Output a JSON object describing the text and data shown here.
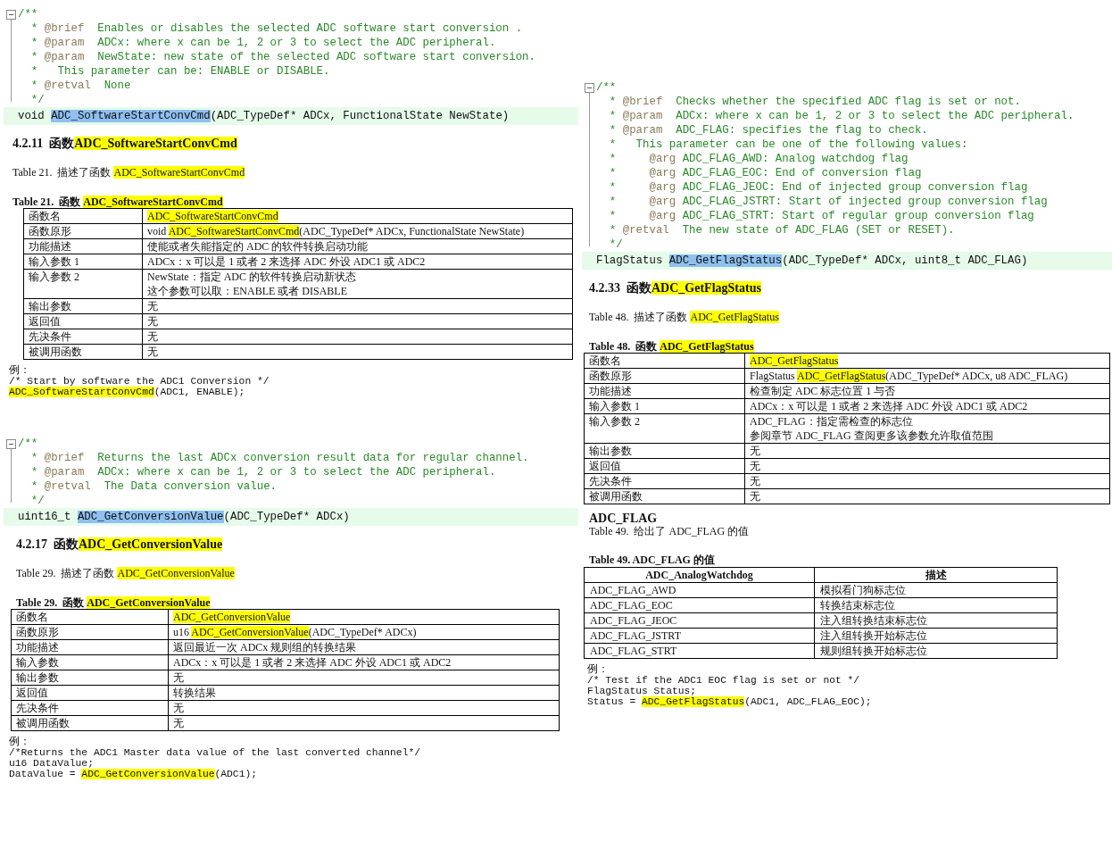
{
  "columns": [
    {
      "sections": [
        {
          "code": {
            "lines": [
              {
                "kind": "open",
                "text": "/**"
              },
              {
                "kind": "tag",
                "lead": "*",
                "tag": "@brief",
                "text": "Enables or disables the selected ADC software start conversion ."
              },
              {
                "kind": "tag",
                "lead": "*",
                "tag": "@param",
                "text": "ADCx: where x can be 1, 2 or 3 to select the ADC peripheral."
              },
              {
                "kind": "tag",
                "lead": "*",
                "tag": "@param",
                "text": "NewState: new state of the selected ADC software start conversion."
              },
              {
                "kind": "plain",
                "lead": "*",
                "text": "This parameter can be: ENABLE or DISABLE."
              },
              {
                "kind": "tag",
                "lead": "*",
                "tag": "@retval",
                "text": "None"
              },
              {
                "kind": "close",
                "text": "*/"
              }
            ],
            "signature": [
              {
                "text": "void ",
                "selected": false
              },
              {
                "text": "ADC_SoftwareStartConvCmd",
                "selected": true
              },
              {
                "text": "(ADC_TypeDef* ADCx, FunctionalState NewState)",
                "selected": false
              }
            ]
          },
          "heading": {
            "number": "4.2.11",
            "parts": [
              {
                "text": "函数",
                "highlight": false
              },
              {
                "text": "ADC_SoftwareStartConvCmd",
                "highlight": true
              }
            ]
          },
          "description": [
            {
              "text": "Table 21.  描述了函数 ",
              "highlight": false
            },
            {
              "text": "ADC_SoftwareStartConvCmd",
              "highlight": true
            }
          ],
          "caption": [
            {
              "text": "Table 21.  函数 ",
              "highlight": false
            },
            {
              "text": "ADC_SoftwareStartConvCmd",
              "highlight": true
            }
          ],
          "table": [
            {
              "label": "函数名",
              "lines": [
                [
                  {
                    "text": "ADC_SoftwareStartConvCmd",
                    "highlight": true
                  }
                ]
              ]
            },
            {
              "label": "函数原形",
              "lines": [
                [
                  {
                    "text": "void ",
                    "highlight": false
                  },
                  {
                    "text": "ADC_SoftwareStartConvCmd",
                    "highlight": true
                  },
                  {
                    "text": "(ADC_TypeDef* ADCx, FunctionalState NewState)",
                    "highlight": false
                  }
                ]
              ]
            },
            {
              "label": "功能描述",
              "lines": [
                "使能或者失能指定的 ADC 的软件转换启动功能"
              ]
            },
            {
              "label": "输入参数 1",
              "lines": [
                "ADCx：x 可以是 1 或者 2 来选择 ADC 外设 ADC1 或 ADC2"
              ]
            },
            {
              "label": "输入参数 2",
              "lines": [
                "NewState：指定 ADC 的软件转换启动新状态",
                "这个参数可以取：ENABLE 或者 DISABLE"
              ]
            },
            {
              "label": "输出参数",
              "lines": [
                "无"
              ]
            },
            {
              "label": "返回值",
              "lines": [
                "无"
              ]
            },
            {
              "label": "先决条件",
              "lines": [
                "无"
              ]
            },
            {
              "label": "被调用函数",
              "lines": [
                "无"
              ]
            }
          ],
          "example": {
            "label": "例：",
            "lines": [
              "/* Start by software the ADC1 Conversion */",
              [
                {
                  "text": "ADC_SoftwareStartConvCmd",
                  "highlight": true
                },
                {
                  "text": "(ADC1, ENABLE);",
                  "highlight": false
                }
              ]
            ]
          }
        },
        {
          "code": {
            "lines": [
              {
                "kind": "open",
                "text": "/**"
              },
              {
                "kind": "tag",
                "lead": "*",
                "tag": "@brief",
                "text": "Returns the last ADCx conversion result data for regular channel."
              },
              {
                "kind": "tag",
                "lead": "*",
                "tag": "@param",
                "text": "ADCx: where x can be 1, 2 or 3 to select the ADC peripheral."
              },
              {
                "kind": "tag",
                "lead": "*",
                "tag": "@retval",
                "text": "The Data conversion value."
              },
              {
                "kind": "close",
                "text": "*/"
              }
            ],
            "signature": [
              {
                "text": "uint16_t ",
                "selected": false
              },
              {
                "text": "ADC_GetConversionValue",
                "selected": true
              },
              {
                "text": "(ADC_TypeDef* ADCx)",
                "selected": false
              }
            ]
          },
          "heading": {
            "number": "4.2.17",
            "parts": [
              {
                "text": "函数",
                "highlight": false
              },
              {
                "text": "ADC_GetConversionValue",
                "highlight": true
              }
            ]
          },
          "description": [
            {
              "text": "Table 29.  描述了函数 ",
              "highlight": false
            },
            {
              "text": "ADC_GetConversionValue",
              "highlight": true
            }
          ],
          "caption": [
            {
              "text": "Table 29.  函数 ",
              "highlight": false
            },
            {
              "text": "ADC_GetConversionValue",
              "highlight": true
            }
          ],
          "table": [
            {
              "label": "函数名",
              "lines": [
                [
                  {
                    "text": "ADC_GetConversionValue",
                    "highlight": true
                  }
                ]
              ]
            },
            {
              "label": "函数原形",
              "lines": [
                [
                  {
                    "text": "u16 ",
                    "highlight": false
                  },
                  {
                    "text": "ADC_GetConversionValue",
                    "highlight": true
                  },
                  {
                    "text": "(ADC_TypeDef* ADCx)",
                    "highlight": false
                  }
                ]
              ]
            },
            {
              "label": "功能描述",
              "lines": [
                "返回最近一次 ADCx 规则组的转换结果"
              ]
            },
            {
              "label": "输入参数",
              "lines": [
                "ADCx：x 可以是 1 或者 2 来选择 ADC 外设 ADC1 或 ADC2"
              ]
            },
            {
              "label": "输出参数",
              "lines": [
                "无"
              ]
            },
            {
              "label": "返回值",
              "lines": [
                "转换结果"
              ]
            },
            {
              "label": "先决条件",
              "lines": [
                "无"
              ]
            },
            {
              "label": "被调用函数",
              "lines": [
                "无"
              ]
            }
          ],
          "example": {
            "label": "例：",
            "lines": [
              "/*Returns the ADC1 Master data value of the last converted channel*/",
              "u16 DataValue;",
              [
                {
                  "text": "DataValue = ",
                  "highlight": false
                },
                {
                  "text": "ADC_GetConversionValue",
                  "highlight": true
                },
                {
                  "text": "(ADC1);",
                  "highlight": false
                }
              ]
            ]
          }
        }
      ]
    },
    {
      "sections": [
        {
          "code": {
            "lines": [
              {
                "kind": "open",
                "text": "/**"
              },
              {
                "kind": "tag",
                "lead": "*",
                "tag": "@brief",
                "text": "Checks whether the specified ADC flag is set or not."
              },
              {
                "kind": "tag",
                "lead": "*",
                "tag": "@param",
                "text": "ADCx: where x can be 1, 2 or 3 to select the ADC peripheral."
              },
              {
                "kind": "tag",
                "lead": "*",
                "tag": "@param",
                "text": "ADC_FLAG: specifies the flag to check."
              },
              {
                "kind": "plain",
                "lead": "*",
                "text": "This parameter can be one of the following values:"
              },
              {
                "kind": "arg",
                "lead": "*",
                "tag": "@arg",
                "text": "ADC_FLAG_AWD: Analog watchdog flag"
              },
              {
                "kind": "arg",
                "lead": "*",
                "tag": "@arg",
                "text": "ADC_FLAG_EOC: End of conversion flag"
              },
              {
                "kind": "arg",
                "lead": "*",
                "tag": "@arg",
                "text": "ADC_FLAG_JEOC: End of injected group conversion flag"
              },
              {
                "kind": "arg",
                "lead": "*",
                "tag": "@arg",
                "text": "ADC_FLAG_JSTRT: Start of injected group conversion flag"
              },
              {
                "kind": "arg",
                "lead": "*",
                "tag": "@arg",
                "text": "ADC_FLAG_STRT: Start of regular group conversion flag"
              },
              {
                "kind": "tag",
                "lead": "*",
                "tag": "@retval",
                "text": "The new state of ADC_FLAG (SET or RESET)."
              },
              {
                "kind": "close",
                "text": "*/"
              }
            ],
            "signature": [
              {
                "text": "FlagStatus ",
                "selected": false
              },
              {
                "text": "ADC_GetFlagStatus",
                "selected": true
              },
              {
                "text": "(ADC_TypeDef* ADCx, uint8_t ADC_FLAG)",
                "selected": false
              }
            ]
          },
          "heading": {
            "number": "4.2.33",
            "parts": [
              {
                "text": "函数",
                "highlight": false
              },
              {
                "text": "ADC_GetFlagStatus",
                "highlight": true
              }
            ]
          },
          "description": [
            {
              "text": "Table 48.  描述了函数 ",
              "highlight": false
            },
            {
              "text": "ADC_GetFlagStatus",
              "highlight": true
            }
          ],
          "caption": [
            {
              "text": "Table 48.  函数 ",
              "highlight": false
            },
            {
              "text": "ADC_GetFlagStatus",
              "highlight": true
            }
          ],
          "table": [
            {
              "label": "函数名",
              "lines": [
                [
                  {
                    "text": "ADC_GetFlagStatus",
                    "highlight": true
                  }
                ]
              ]
            },
            {
              "label": "函数原形",
              "lines": [
                [
                  {
                    "text": "FlagStatus ",
                    "highlight": false
                  },
                  {
                    "text": "ADC_GetFlagStatus",
                    "highlight": true
                  },
                  {
                    "text": "(ADC_TypeDef* ADCx, u8 ADC_FLAG)",
                    "highlight": false
                  }
                ]
              ]
            },
            {
              "label": "功能描述",
              "lines": [
                "检查制定 ADC 标志位置 1 与否"
              ]
            },
            {
              "label": "输入参数 1",
              "lines": [
                "ADCx：x 可以是 1 或者 2 来选择 ADC 外设 ADC1 或 ADC2"
              ]
            },
            {
              "label": "输入参数 2",
              "lines": [
                "ADC_FLAG：指定需检查的标志位",
                "参阅章节 ADC_FLAG 查阅更多该参数允许取值范围"
              ]
            },
            {
              "label": "输出参数",
              "lines": [
                "无"
              ]
            },
            {
              "label": "返回值",
              "lines": [
                "无"
              ]
            },
            {
              "label": "先决条件",
              "lines": [
                "无"
              ]
            },
            {
              "label": "被调用函数",
              "lines": [
                "无"
              ]
            }
          ]
        }
      ],
      "flag_values": {
        "title": "ADC_FLAG",
        "description": "Table 49.  给出了 ADC_FLAG 的值",
        "caption": "Table 49. ADC_FLAG 的值",
        "columns": [
          "ADC_AnalogWatchdog",
          "描述"
        ],
        "rows": [
          [
            "ADC_FLAG_AWD",
            "模拟看门狗标志位"
          ],
          [
            "ADC_FLAG_EOC",
            "转换结束标志位"
          ],
          [
            "ADC_FLAG_JEOC",
            "注入组转换结束标志位"
          ],
          [
            "ADC_FLAG_JSTRT",
            "注入组转换开始标志位"
          ],
          [
            "ADC_FLAG_STRT",
            "规则组转换开始标志位"
          ]
        ],
        "example": {
          "label": "例：",
          "lines": [
            "/* Test if the ADC1 EOC flag is set or not */",
            "FlagStatus Status;",
            [
              {
                "text": "Status = ",
                "highlight": false
              },
              {
                "text": "ADC_GetFlagStatus",
                "highlight": true
              },
              {
                "text": "(ADC1, ADC_FLAG_EOC);",
                "highlight": false
              }
            ]
          ]
        }
      }
    }
  ]
}
